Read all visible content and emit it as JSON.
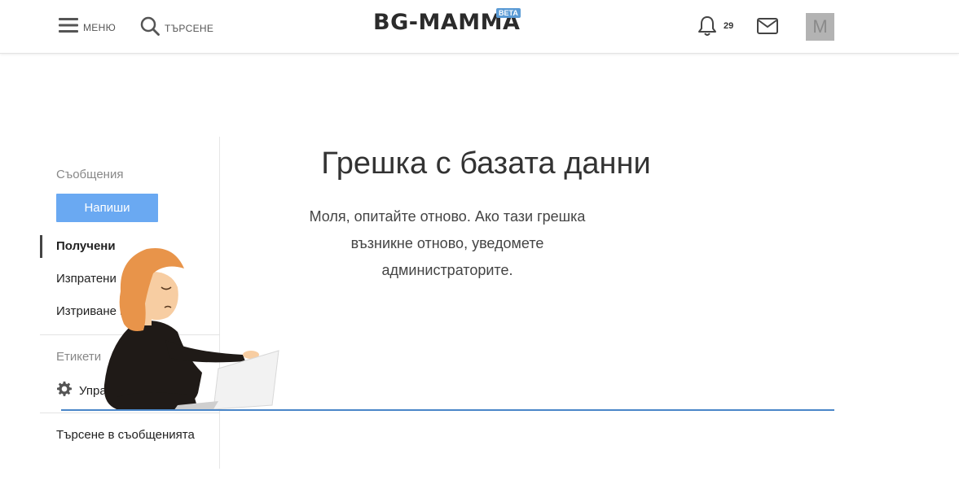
{
  "header": {
    "menu_label": "МЕНЮ",
    "search_label": "ТЪРСЕНЕ",
    "logo_text": "BG-MAMMA",
    "logo_badge": "BETA",
    "notification_count": "29",
    "avatar_letter": "M"
  },
  "sidebar": {
    "messages_title": "Съобщения",
    "compose_label": "Напиши",
    "items": [
      {
        "label": "Получени",
        "active": true
      },
      {
        "label": "Изпратени",
        "active": false
      },
      {
        "label": "Изтриване на стари",
        "active": false
      }
    ],
    "labels_title": "Етикети",
    "manage_label": "Управление",
    "search_messages_label": "Търсене в съобщенията"
  },
  "main": {
    "error_title": "Грешка с базата данни",
    "error_message": "Моля, опитайте отново. Ако тази грешка възникне отново, уведомете администраторите."
  },
  "colors": {
    "accent": "#6aa9f2",
    "line": "#4a86c8",
    "hair": "#e8944a",
    "skin": "#f7cda2",
    "clothing": "#1f1a17"
  }
}
